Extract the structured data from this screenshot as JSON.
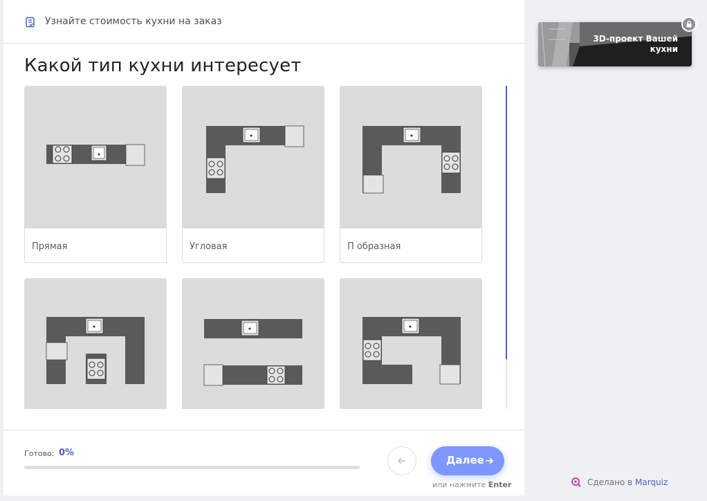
{
  "header": {
    "title": "Узнайте стоимость кухни на заказ",
    "icon": "document-list-icon"
  },
  "question": {
    "title": "Какой тип кухни интересует"
  },
  "options": [
    {
      "label": "Прямая",
      "icon": "straight-kitchen-icon"
    },
    {
      "label": "Угловая",
      "icon": "corner-kitchen-icon"
    },
    {
      "label": "П образная",
      "icon": "u-shaped-kitchen-icon"
    },
    {
      "label": "",
      "icon": "u-shaped-island-kitchen-icon"
    },
    {
      "label": "",
      "icon": "parallel-kitchen-icon"
    },
    {
      "label": "",
      "icon": "g-shaped-kitchen-icon"
    }
  ],
  "footer": {
    "progress_label": "Готово:",
    "progress_value": "0%",
    "progress_fraction": 0,
    "next_label": "Далее",
    "hint_prefix": "или нажмите",
    "hint_key": "Enter"
  },
  "sidebar": {
    "promo_text": "3D-проект Вашей кухни",
    "made_with_prefix": "Сделано в",
    "made_with_brand": "Marquiz"
  },
  "colors": {
    "accent": "#4a5fc1",
    "button": "#7d97ff",
    "counter": "#555555",
    "thumb_bg": "#dcdcdc"
  }
}
